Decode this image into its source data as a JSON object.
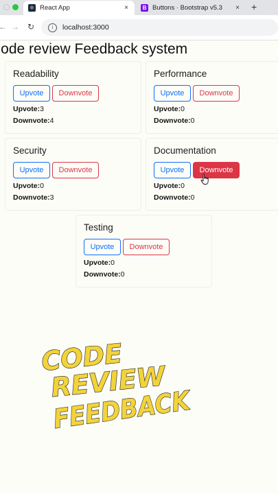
{
  "browser": {
    "tabs": [
      {
        "title": "React App",
        "favicon": "react-logo-icon",
        "active": true
      },
      {
        "title": "Buttons · Bootstrap v5.3",
        "favicon": "bootstrap-logo-icon",
        "active": false
      }
    ],
    "close_glyph": "×",
    "new_tab_glyph": "+",
    "url": "localhost:3000"
  },
  "page": {
    "title": "Code review Feedback system",
    "upvote_label": "Upvote",
    "downvote_label": "Downvote",
    "upvote_text": "Upvote:",
    "downvote_text": "Downvote:",
    "colors": {
      "primary": "#0d6efd",
      "danger": "#dc3545"
    },
    "cards": [
      {
        "title": "Readability",
        "upvotes": "3",
        "downvotes": "4"
      },
      {
        "title": "Performance",
        "upvotes": "0",
        "downvotes": "0"
      },
      {
        "title": "Security",
        "upvotes": "0",
        "downvotes": "3"
      },
      {
        "title": "Documentation",
        "upvotes": "0",
        "downvotes": "0"
      },
      {
        "title": "Testing",
        "upvotes": "0",
        "downvotes": "0"
      }
    ]
  },
  "overlay": {
    "lines": [
      "CODE",
      "REVIEW",
      "FEEDBACK"
    ],
    "color": "#f2d33c"
  }
}
